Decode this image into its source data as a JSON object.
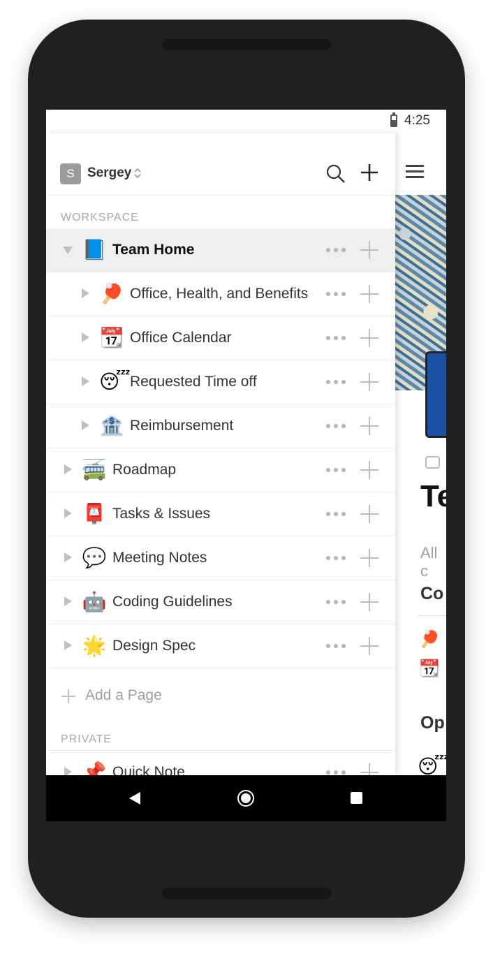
{
  "status_bar": {
    "time": "4:25"
  },
  "sidebar": {
    "workspace_initial": "S",
    "workspace_name": "Sergey",
    "section_workspace": "WORKSPACE",
    "section_private": "PRIVATE",
    "add_page_label": "Add a Page",
    "pages": [
      {
        "icon": "📘",
        "label": "Team Home"
      },
      {
        "icon": "🏓",
        "label": "Office, Health, and Benefits"
      },
      {
        "icon": "📆",
        "label": "Office Calendar"
      },
      {
        "icon": "😴",
        "label": "Requested Time off"
      },
      {
        "icon": "🏦",
        "label": "Reimbursement"
      },
      {
        "icon": "🚎",
        "label": "Roadmap"
      },
      {
        "icon": "📮",
        "label": "Tasks & Issues"
      },
      {
        "icon": "💬",
        "label": "Meeting Notes"
      },
      {
        "icon": "🤖",
        "label": "Coding Guidelines"
      },
      {
        "icon": "🌟",
        "label": "Design Spec"
      }
    ],
    "private_pages": [
      {
        "icon": "📌",
        "label": "Quick Note"
      }
    ]
  },
  "content": {
    "title": "Te",
    "subtitle": "All c",
    "heading1": "Co",
    "heading2": "Op",
    "list_icons": [
      "🏓",
      "📆"
    ],
    "list_icon_2": "😴"
  },
  "icons": {
    "search": "search-icon",
    "plus": "plus-icon",
    "menu": "hamburger-menu-icon",
    "more": "more-dots-icon",
    "back": "back-icon",
    "home": "home-icon",
    "recents": "recents-icon"
  }
}
